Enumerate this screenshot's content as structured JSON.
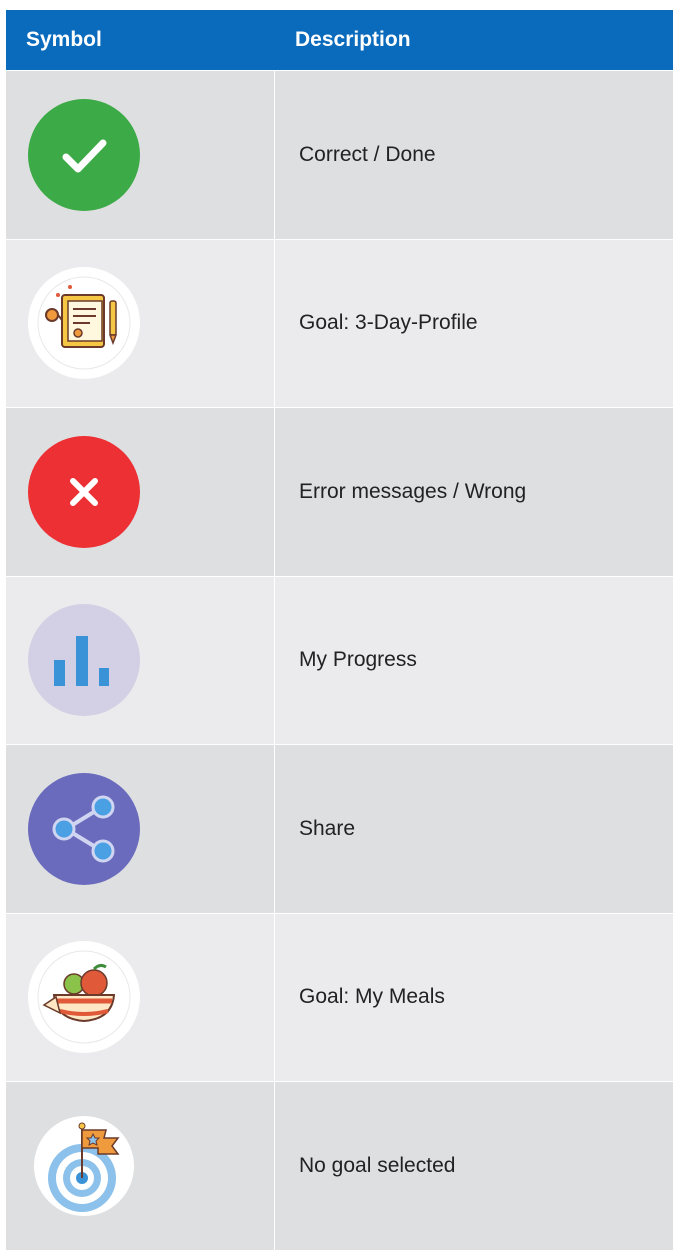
{
  "table": {
    "header": {
      "symbol": "Symbol",
      "description": "Description"
    },
    "rows": [
      {
        "icon": "check-circle-icon",
        "description": "Correct / Done",
        "color": "#3caa47"
      },
      {
        "icon": "clipboard-profile-icon",
        "description": "Goal: 3-Day-Profile",
        "color": "#f6c744"
      },
      {
        "icon": "error-x-icon",
        "description": "Error messages / Wrong",
        "color": "#ec3034"
      },
      {
        "icon": "bar-chart-icon",
        "description": "My Progress",
        "color": "#3a93d6"
      },
      {
        "icon": "share-icon",
        "description": "Share",
        "color": "#6a6bbd"
      },
      {
        "icon": "meal-bowl-icon",
        "description": "Goal: My Meals",
        "color": "#e05a3a"
      },
      {
        "icon": "target-flag-icon",
        "description": "No goal selected",
        "color": "#8bc1ea"
      }
    ]
  }
}
